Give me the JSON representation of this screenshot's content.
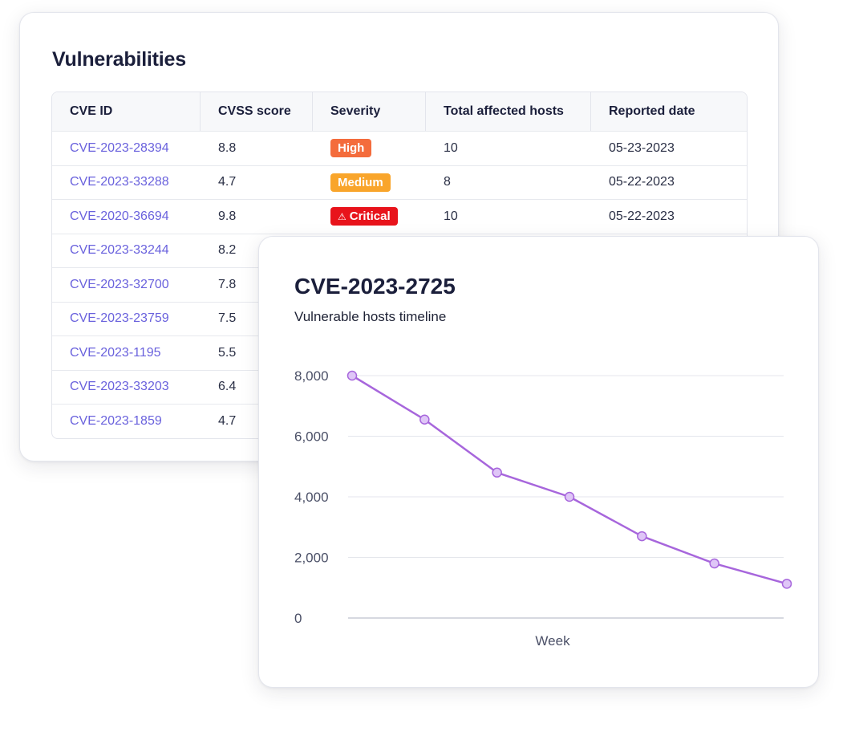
{
  "vulnerabilities": {
    "title": "Vulnerabilities",
    "columns": [
      "CVE ID",
      "CVSS score",
      "Severity",
      "Total affected hosts",
      "Reported date"
    ],
    "rows": [
      {
        "cve": "CVE-2023-28394",
        "score": "8.8",
        "severity": "High",
        "severity_level": "high",
        "hosts": "10",
        "date": "05-23-2023"
      },
      {
        "cve": "CVE-2023-33288",
        "score": "4.7",
        "severity": "Medium",
        "severity_level": "medium",
        "hosts": "8",
        "date": "05-22-2023"
      },
      {
        "cve": "CVE-2020-36694",
        "score": "9.8",
        "severity": "Critical",
        "severity_level": "critical",
        "hosts": "10",
        "date": "05-22-2023"
      },
      {
        "cve": "CVE-2023-33244",
        "score": "8.2",
        "severity": "",
        "severity_level": "",
        "hosts": "",
        "date": ""
      },
      {
        "cve": "CVE-2023-32700",
        "score": "7.8",
        "severity": "",
        "severity_level": "",
        "hosts": "",
        "date": ""
      },
      {
        "cve": "CVE-2023-23759",
        "score": "7.5",
        "severity": "",
        "severity_level": "",
        "hosts": "",
        "date": ""
      },
      {
        "cve": "CVE-2023-1195",
        "score": "5.5",
        "severity": "",
        "severity_level": "",
        "hosts": "",
        "date": ""
      },
      {
        "cve": "CVE-2023-33203",
        "score": "6.4",
        "severity": "",
        "severity_level": "",
        "hosts": "",
        "date": ""
      },
      {
        "cve": "CVE-2023-1859",
        "score": "4.7",
        "severity": "",
        "severity_level": "",
        "hosts": "",
        "date": ""
      }
    ]
  },
  "timeline": {
    "title": "CVE-2023-2725",
    "subtitle": "Vulnerable hosts timeline"
  },
  "colors": {
    "link": "#6a62dd",
    "high": "#f46c3c",
    "medium": "#f9a52b",
    "critical": "#e8131b",
    "line": "#a766dc",
    "point_fill": "#dfc6f7"
  },
  "chart_data": {
    "type": "line",
    "title": "CVE-2023-2725",
    "subtitle": "Vulnerable hosts timeline",
    "xlabel": "Week",
    "ylabel": "",
    "ylim": [
      0,
      8000
    ],
    "yticks": [
      "0",
      "2,000",
      "4,000",
      "6,000",
      "8,000"
    ],
    "ytick_values": [
      0,
      2000,
      4000,
      6000,
      8000
    ],
    "grid": true,
    "series": [
      {
        "values": [
          8000,
          6550,
          4800,
          4000,
          2700,
          1800,
          1130
        ]
      }
    ]
  }
}
